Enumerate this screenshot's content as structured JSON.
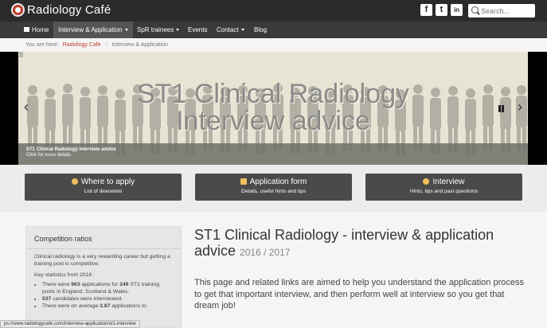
{
  "site": {
    "name": "Radiology Café"
  },
  "social": {
    "facebook": "f",
    "twitter": "t",
    "linkedin": "in"
  },
  "search": {
    "placeholder": "Search..."
  },
  "nav": {
    "home": "Home",
    "interview": "Interview & Application",
    "spr": "SpR trainees",
    "events": "Events",
    "contact": "Contact",
    "blog": "Blog"
  },
  "breadcrumb": {
    "prefix": "You are here:",
    "link": "Radiology Cafe",
    "current": "Interview & Application"
  },
  "carousel": {
    "title_line1": "ST1 Clinical Radiology",
    "title_line2": "Interview advice",
    "caption_title": "ST1 Clinical Radiology interview advice",
    "caption_sub": "Click for more details",
    "prev": "‹",
    "next": "›"
  },
  "features": [
    {
      "title": "Where to apply",
      "sub": "List of deaneries"
    },
    {
      "title": "Application form",
      "sub": "Details, useful hints and tips"
    },
    {
      "title": "Interview",
      "sub": "Hints, tips and past questions"
    }
  ],
  "sidebar": {
    "heading": "Competition ratios",
    "intro": "Clinical radiology is a very rewarding career but getting a training post is competitive.",
    "stats_label": "Key statistics from 2016 :",
    "b1_pre": "There were ",
    "b1_num1": "963",
    "b1_mid": " applications for ",
    "b1_num2": "249",
    "b1_post": " ST1 training posts in England, Scotland & Wales.",
    "b2_num": "537",
    "b2_post": " candidates were interviewed.",
    "b3_pre": "There were on average ",
    "b3_num": "3.87",
    "b3_post": " applications to"
  },
  "main": {
    "title": "ST1 Clinical Radiology - interview & application advice",
    "year": "2016 / 2017",
    "intro": "This page and related links are aimed to help you understand the application process to get that important interview, and then perform well at interview so you get that dream job!"
  },
  "status": {
    "url": "ps://www.radiologycafe.com/interview-application/st1-interview"
  }
}
